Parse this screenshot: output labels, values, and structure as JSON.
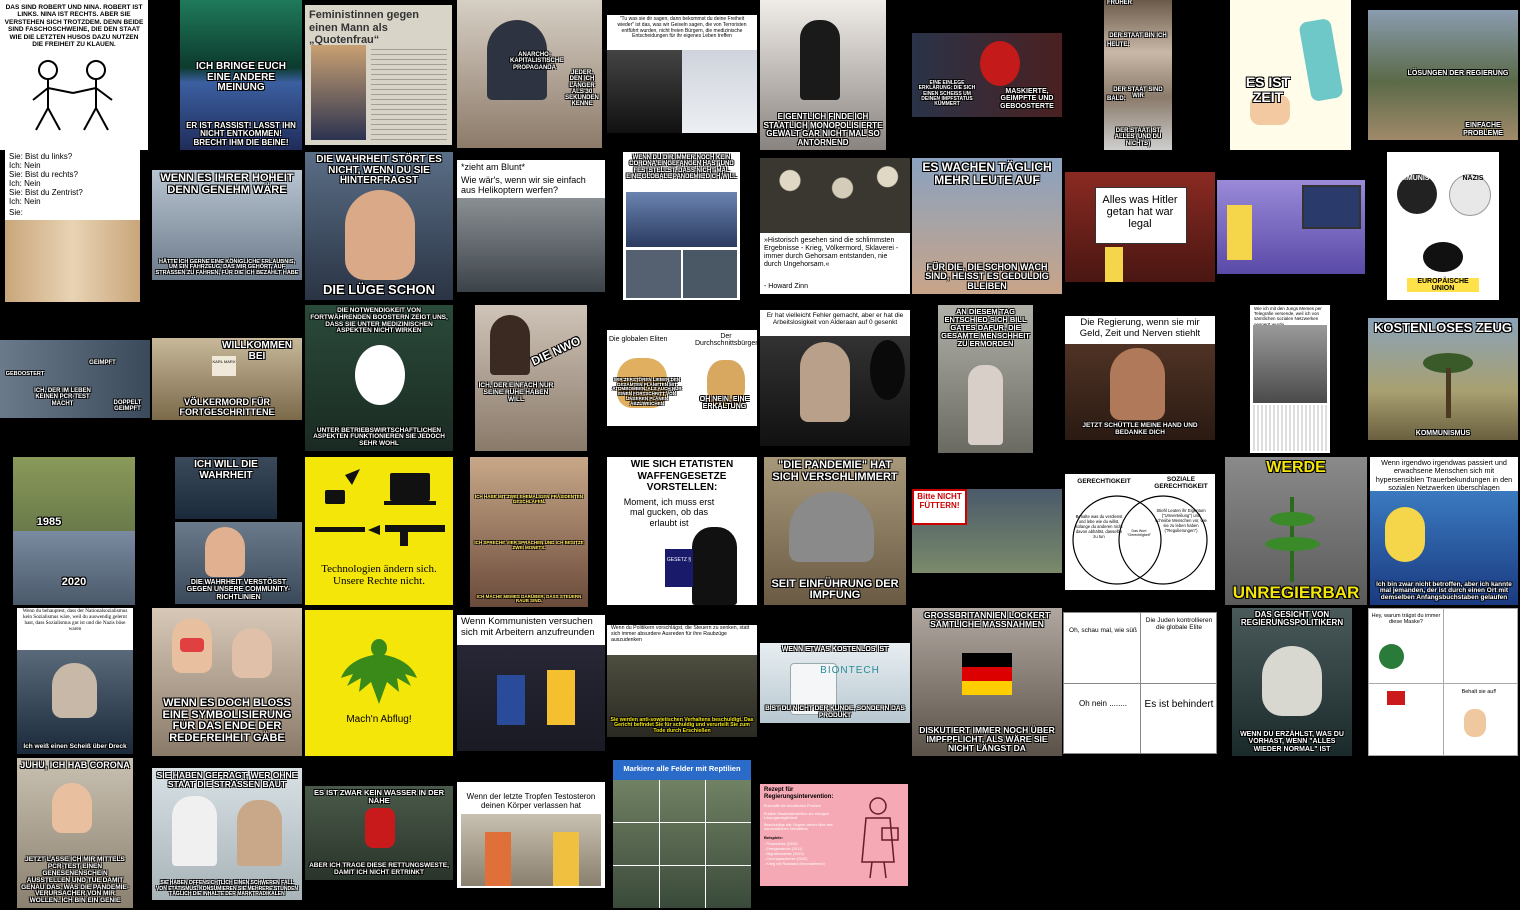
{
  "grid": [
    {
      "id": "r1c1",
      "texts": [
        "DAS SIND ROBERT UND NINA. ROBERT IST LINKS. NINA IST RECHTS. ABER SIE VERSTEHEN SICH TROTZDEM. DENN BEIDE SIND FASCHOSCHWEINE, DIE DEN STAAT WIE DIE LETZTEN HUSOS DAZU NUTZEN DIE FREIHEIT ZU KLAUEN."
      ]
    },
    {
      "id": "r1c2",
      "texts": [
        "ICH BRINGE EUCH EINE ANDERE MEINUNG",
        "ER IST RASSIST! LASST IHN NICHT ENTKOMMEN! BRECHT IHM DIE BEINE!"
      ]
    },
    {
      "id": "r1c3",
      "texts": [
        "Feministinnen gegen einen Mann als „Quotenfrau“"
      ]
    },
    {
      "id": "r1c4",
      "texts": [
        "anarcho-kapitalistische Propaganda",
        "Jeder, den ich länger als 30 Sekunden kenne"
      ]
    },
    {
      "id": "r1c5",
      "texts": [
        "\"Tu was sie dir sagen, dann bekommst du deine Freiheit wieder\" ist das, was wir Geiseln sagen, die von Terroristen entführt wurden, nicht freien Bürgern, die medizinische Entscheidungen für ihr eigenes Leben treffen"
      ]
    },
    {
      "id": "r1c6",
      "texts": [
        "EIGENTLICH FINDE ICH STAATLICH MONOPOLISIERTE GEWALT GAR NICHT MAL SO ANTÖRNEND"
      ]
    },
    {
      "id": "r1c7",
      "texts": [
        "EINE EINLEGE ERKLÄRUNG: DIE SICH EINEN SCHEISS UM DEINEN IMPFSTATUS KÜMMERT",
        "MASKIERTE, GEIMPFTE UND GEBOOSTERTE"
      ]
    },
    {
      "id": "r1c8",
      "texts": [
        "FRÜHER",
        "DER STAAT BIN ICH",
        "HEUTE:",
        "DER STAAT SIND WIR",
        "BALD:",
        "DER STAAT IST ALLES (UND DU NICHTS)"
      ]
    },
    {
      "id": "r1c9",
      "texts": [
        "ES IST ZEIT"
      ]
    },
    {
      "id": "r1c10",
      "texts": [
        "LÖSUNGEN DER REGIERUNG",
        "EINFACHE PROBLEME"
      ]
    },
    {
      "id": "r2c1",
      "texts": [
        "Sie: Bist du links?",
        "Ich: Nein",
        "Sie: Bist du rechts?",
        "Ich: Nein",
        "Sie: Bist du Zentrist?",
        "Ich: Nein",
        "Sie:"
      ]
    },
    {
      "id": "r2c2",
      "texts": [
        "WENN ES IHRER HOHEIT DENN GENEHM WÄRE",
        "HÄTTE ICH GERNE EINE KÖNIGLICHE ERLAUBNIS, UM EIN FAHRZEUG, DAS MIR GEHÖRT, AUF STRASSEN ZU FAHREN, FÜR DIE ICH BEZAHLT HABE"
      ]
    },
    {
      "id": "r2c3",
      "texts": [
        "DIE WAHRHEIT STÖRT ES NICHT, WENN DU SIE HINTERFRAGST",
        "DIE LÜGE SCHON"
      ]
    },
    {
      "id": "r2c4",
      "texts": [
        "*zieht am Blunt*",
        "Wie wär's, wenn wir sie einfach aus Helikoptern werfen?"
      ]
    },
    {
      "id": "r2c5",
      "texts": [
        "WENN DU DIR IMMER NOCH KEIN CORONA EINGEFANGEN HAST UND FESTSTELLST, DASS NICHT MAL EINE GLOBALE PANDEMIE DICH WILL"
      ]
    },
    {
      "id": "r2c6",
      "texts": [
        "»Historisch gesehen sind die schlimmsten Ergebnisse - Krieg, Völkermord, Sklaverei - immer durch Gehorsam entstanden, nie durch Ungehorsam.«",
        "- Howard Zinn"
      ]
    },
    {
      "id": "r2c7",
      "texts": [
        "ES WACHEN TÄGLICH MEHR LEUTE AUF",
        "FÜR DIE, DIE SCHON WACH SIND, HEISST ES GEDULDIG BLEIBEN"
      ]
    },
    {
      "id": "r2c8",
      "texts": [
        "Alles was Hitler getan hat war legal"
      ]
    },
    {
      "id": "r2c9",
      "texts": []
    },
    {
      "id": "r2c10",
      "texts": [
        "KOMMUNISTEN",
        "NAZIS",
        "EUROPÄISCHE UNION"
      ]
    },
    {
      "id": "r3c1",
      "texts": [
        "GEBOOSTERT",
        "GEIMPFT",
        "ICH, DER IM LEBEN KEINEN PCR-TEST MACHT",
        "DOPPELT GEIMPFT"
      ]
    },
    {
      "id": "r3c2",
      "texts": [
        "WILLKOMMEN BEI",
        "VÖLKERMORD FÜR FORTGESCHRITTENE",
        "KARL MARX"
      ]
    },
    {
      "id": "r3c3",
      "texts": [
        "DIE NOTWENDIGKEIT VON FORTWÄHRENDEN BOOSTERN ZEIGT UNS, DASS SIE UNTER MEDIZINISCHEN ASPEKTEN NICHT WIRKEN",
        "UNTER BETRIEBSWIRTSCHAFTLICHEN ASPEKTEN FUNKTIONIEREN SIE JEDOCH SEHR WOHL"
      ]
    },
    {
      "id": "r3c4",
      "texts": [
        "Die NWO",
        "Ich, der einfach nur seine Ruhe haben will"
      ]
    },
    {
      "id": "r3c5",
      "texts": [
        "Die globalen Eliten",
        "Der Durchschnittsbürger",
        "WIR ZERSTÖREN LIEBER DEN GESAMTEN PLANETEN MIT ATOMBOMBEN, ALS AUCH NUR EINEN FORTSCHRITT VON UNSEREN PLÄNEN ABZUWEICHEN",
        "OH NEIN, EINE ERKÄLTUNG"
      ]
    },
    {
      "id": "r3c6",
      "texts": [
        "Er hat vielleicht Fehler gemacht, aber er hat die Arbeitslosigkeit von Alderaan auf 0 gesenkt"
      ]
    },
    {
      "id": "r3c7",
      "texts": [
        "AN DIESEM TAG ENTSCHIED SICH BILL GATES DAFÜR, DIE GESAMTE MENSCHHEIT ZU ERMORDEN"
      ]
    },
    {
      "id": "r3c8",
      "texts": [
        "Die Regierung, wenn sie mir Geld, Zeit und Nerven stiehlt",
        "Jetzt schüttle meine Hand und bedanke dich"
      ]
    },
    {
      "id": "r3c9",
      "texts": [
        "Wie ich mit den Jungs Memes per Telegrafie versende, weil ich von sämtlichen sozialen Netzwerken gesperrt wurde"
      ]
    },
    {
      "id": "r3c10",
      "texts": [
        "KOSTENLOSES ZEUG",
        "KOMMUNISMUS"
      ]
    },
    {
      "id": "r4c1",
      "texts": [
        "1985",
        "2020"
      ]
    },
    {
      "id": "r4c2",
      "texts": [
        "ICH WILL DIE WAHRHEIT",
        "DIE WAHRHEIT VERSTÖSST GEGEN UNSERE COMMUNITY-RICHTLINIEN"
      ]
    },
    {
      "id": "r4c3",
      "texts": [
        "Technologien ändern sich. Unsere Rechte nicht."
      ]
    },
    {
      "id": "r4c4",
      "texts": [
        "Ich habe mit zwei ehemaligen Präsidenten geschlafen.",
        "Ich spreche vier Sprachen und ich besitze zwei Monets.",
        "Ich mache Memes darüber, dass Steuern Raub sind."
      ]
    },
    {
      "id": "r4c5",
      "texts": [
        "WIE SICH ETATISTEN WAFFENGESETZE VORSTELLEN:",
        "Moment, ich muss erst mal gucken, ob das erlaubt ist",
        "GESETZ §"
      ]
    },
    {
      "id": "r4c6",
      "texts": [
        "\"DIE PANDEMIE\" HAT SICH VERSCHLIMMERT",
        "SEIT EINFÜHRUNG DER IMPFUNG"
      ]
    },
    {
      "id": "r4c7",
      "texts": [
        "Bitte NICHT FÜTTERN!"
      ]
    },
    {
      "id": "r4c8",
      "texts": [
        "GERECHTIGKEIT",
        "SOZIALE GERECHTIGKEIT",
        "Behalte was du verdienst und lebe wie du willst, solange du anderen nicht davon abhältst, dasselbe zu tun",
        "Das Wort \"Gerechtigkeit\"",
        "Stiehl Leuten ihr Eigentum (\"Umverteilung\") und schreibe Menschen vor, wie sie zu leben haben (\"Regulierungen\")"
      ]
    },
    {
      "id": "r4c9",
      "texts": [
        "WERDE",
        "UNREGIERBAR"
      ]
    },
    {
      "id": "r4c10",
      "texts": [
        "Wenn irgendwo irgendwas passiert und erwachsene Menschen sich mit hypersensiblen Trauerbekundungen in den sozialen Netzwerken überschlagen",
        "Ich bin zwar nicht betroffen, aber ich kannte mal jemanden, der ist durch einen Ort mit demselben Anfangsbuchstaben gelaufen"
      ]
    },
    {
      "id": "r5c1",
      "texts": [
        "Wenn du behauptest, dass der Nationalsozialismus kein Sozialismus wäre, weil du auswendig gelernt hast, dass Sozialismus gut ist und die Nazis böse waren",
        "Ich weiß einen Scheiß über Dreck"
      ]
    },
    {
      "id": "r5c2",
      "texts": [
        "WENN ES DOCH BLOSS EINE SYMBOLISIERUNG FÜR DAS ENDE DER REDEFREIHEIT GÄBE"
      ]
    },
    {
      "id": "r5c3",
      "texts": [
        "Mach'n Abflug!"
      ]
    },
    {
      "id": "r5c4",
      "texts": [
        "Wenn Kommunisten versuchen sich mit Arbeitern anzufreunden"
      ]
    },
    {
      "id": "r5c5",
      "texts": [
        "Wenn du Politikern vorschlägst, die Steuern zu senken, statt sich immer absurdere Ausreden für ihre Raubzüge auszudenken",
        "Sie werden anti-sowjetischen Verhaltens beschuldigt. Das Gericht befindet Sie für schuldig und verurteilt Sie zum Tode durch Erschießen"
      ]
    },
    {
      "id": "r5c6",
      "texts": [
        "WENN ETWAS KOSTENLOS IST",
        "BIONTECH",
        "BIST DU NICHT DER KUNDE, SONDERN DAS PRODUKT"
      ]
    },
    {
      "id": "r5c7",
      "texts": [
        "GROSSBRITANNIEN LOCKERT SÄMTLICHE MASSNAHMEN",
        "DISKUTIERT IMMER NOCH ÜBER IMPFPFLICHT, ALS WÄRE SIE NICHT LÄNGST DA"
      ]
    },
    {
      "id": "r5c8",
      "texts": [
        "Oh, schau mal, wie süß",
        "Die Juden kontrollieren die globale Elite",
        "Oh nein ........",
        "Es ist behindert"
      ]
    },
    {
      "id": "r5c9",
      "texts": [
        "DAS GESICHT VON REGIERUNGSPOLITIKERN",
        "WENN DU ERZÄHLST, WAS DU VORHAST, WENN \"ALLES WIEDER NORMAL\" IST"
      ]
    },
    {
      "id": "r5c10",
      "texts": [
        "Hey, warum trägst du immer diese Maske?",
        "Behalt sie auf!"
      ]
    },
    {
      "id": "r6c1",
      "texts": [
        "JUHU, ICH HAB CORONA",
        "JETZT LASSE ICH MIR MITTELS PCR-TEST EINEN GENESENENSCHEIN AUSSTELLEN UND TUE DAMIT GENAU DAS, WAS DIE PANDEMIE-VERURSACHER VON MIR WOLLEN. ICH BIN EIN GENIE"
      ]
    },
    {
      "id": "r6c2",
      "texts": [
        "SIE HABEN GEFRAGT, WER OHNE STAAT DIE STRASSEN BAUT",
        "SIE HABEN OFFENSICHTLICH EINEN SCHWEREN FALL VON ETATISMUS. KONSUMIEREN SIE MEHRERE STUNDEN TÄGLICH DIE INHALTE DER MARKTRADIKALEN"
      ]
    },
    {
      "id": "r6c3",
      "texts": [
        "ES IST ZWAR KEIN WASSER IN DER NÄHE",
        "ABER ICH TRAGE DIESE RETTUNGSWESTE, DAMIT ICH NICHT ERTRINKT"
      ]
    },
    {
      "id": "r6c4",
      "texts": [
        "Wenn der letzte Tropfen Testosteron deinen Körper verlassen hat"
      ]
    },
    {
      "id": "r6c5",
      "texts": [
        "Markiere alle Felder mit Reptilien"
      ]
    },
    {
      "id": "r6c6",
      "texts": [
        "Rezept für Regierungsintervention:",
        "Erschaffe ein künstliches Problem",
        "Erkläre Staatsintervention zur einzigen Lösungsmöglichkeit",
        "Beschuldige alle Gegner deiner Idee des unmoralischen Verhaltens",
        "Beispiele:",
        "- Finanzkrise (2008)",
        "- Energiewende (2011)",
        "- Migrationskrise (2015)",
        "- Coronapandemie (2020)",
        "- Krieg mit Russland (bevorstehend)"
      ]
    }
  ],
  "colors": {
    "background": "#000000",
    "caption": "#ffffff",
    "yellow": "#f5e60a",
    "pink": "#f4a9b4"
  }
}
